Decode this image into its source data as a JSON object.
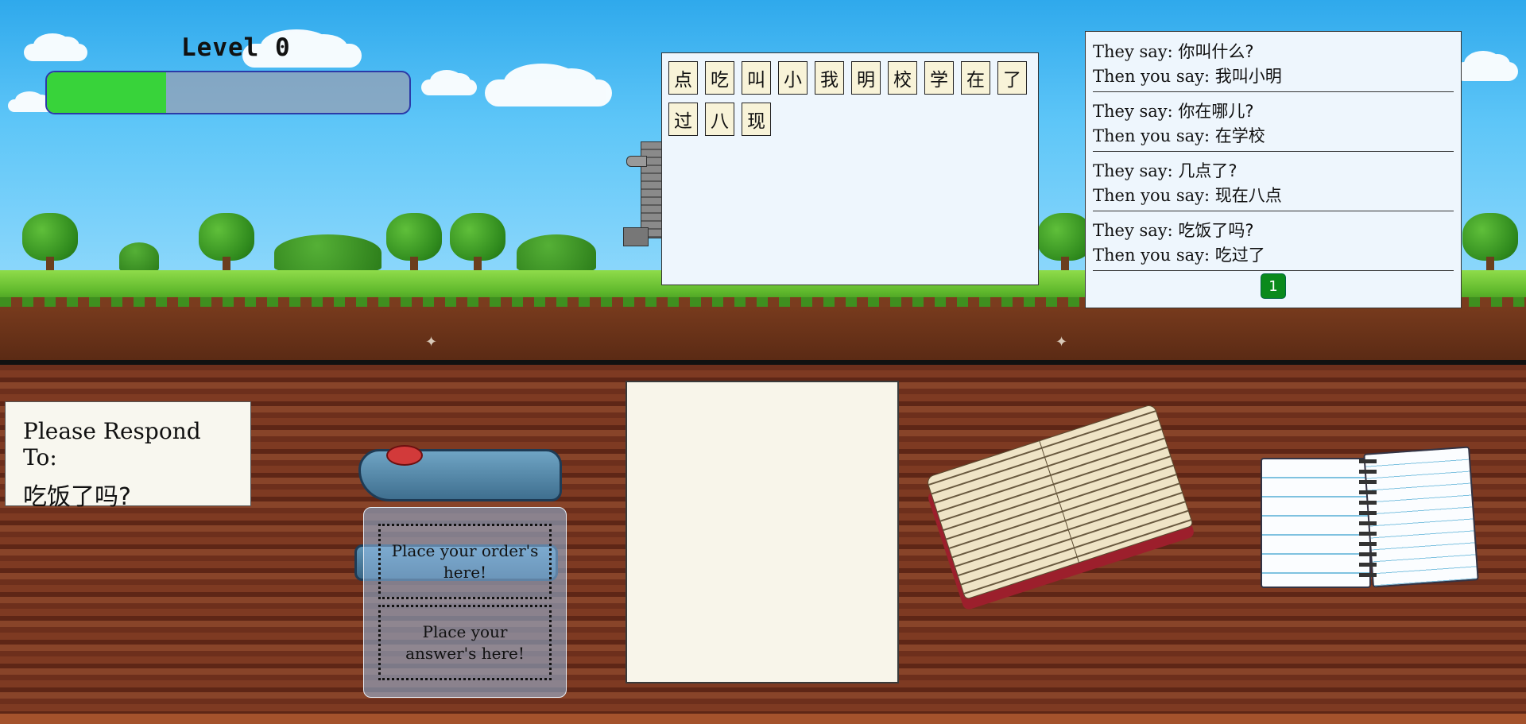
{
  "hud": {
    "level_label": "Level 0",
    "progress_fraction": 0.33
  },
  "tiles": [
    "点",
    "吃",
    "叫",
    "小",
    "我",
    "明",
    "校",
    "学",
    "在",
    "了",
    "过",
    "八",
    "现"
  ],
  "phrase_book": {
    "entries": [
      {
        "they_prefix": "They say: ",
        "they": "你叫什么?",
        "you_prefix": "Then you say: ",
        "you": "我叫小明"
      },
      {
        "they_prefix": "They say: ",
        "they": "你在哪儿?",
        "you_prefix": "Then you say: ",
        "you": "在学校"
      },
      {
        "they_prefix": "They say: ",
        "they": "几点了?",
        "you_prefix": "Then you say: ",
        "you": "现在八点"
      },
      {
        "they_prefix": "They say: ",
        "they": "吃饭了吗?",
        "you_prefix": "Then you say: ",
        "you": "吃过了"
      }
    ],
    "page_button": "1"
  },
  "prompt": {
    "label": "Please Respond To:",
    "phrase": "吃饭了吗?"
  },
  "drop_zone": {
    "order_slot": "Place your order's here!",
    "answer_slot": "Place your answer's here!"
  },
  "colors": {
    "progress_fill": "#38d33a",
    "page_button": "#0a8a1c"
  }
}
